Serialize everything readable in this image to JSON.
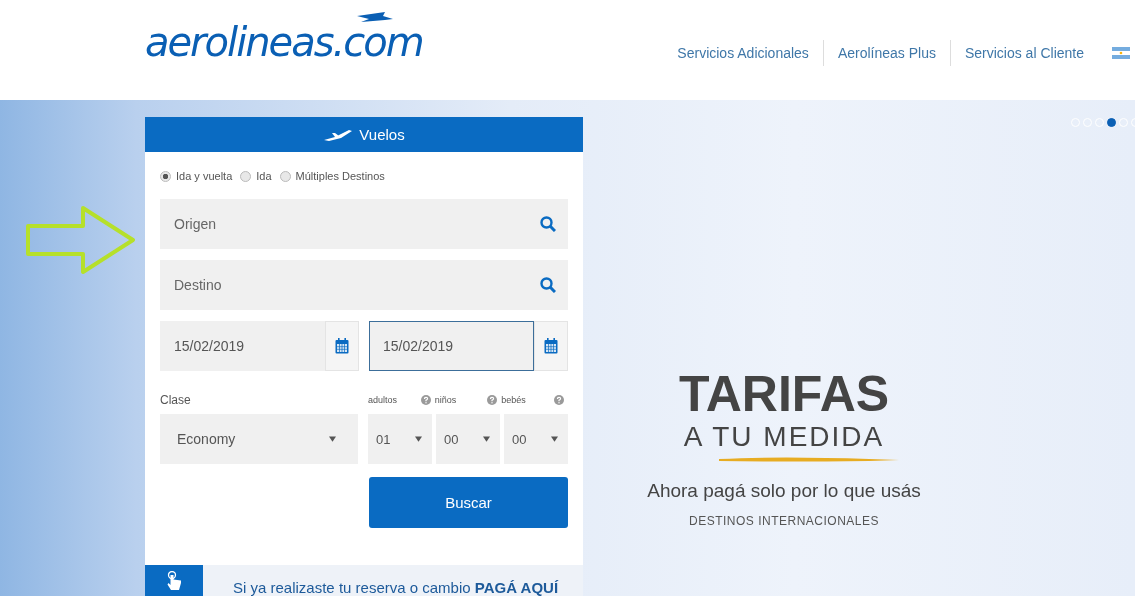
{
  "header": {
    "logo": "aerolineas.com",
    "nav": [
      "Servicios Adicionales",
      "Aerolíneas Plus",
      "Servicios al Cliente"
    ]
  },
  "slider": {
    "dots": [
      {
        "selected": false
      },
      {
        "selected": false
      },
      {
        "selected": false
      },
      {
        "selected": true
      },
      {
        "selected": false
      },
      {
        "selected": false
      }
    ]
  },
  "search": {
    "title": "Vuelos",
    "trip_types": [
      {
        "label": "Ida y vuelta",
        "selected": true
      },
      {
        "label": "Ida",
        "selected": false
      },
      {
        "label": "Múltiples Destinos",
        "selected": false
      }
    ],
    "origin": {
      "placeholder": "Origen"
    },
    "destination": {
      "placeholder": "Destino"
    },
    "dates": [
      {
        "value": "15/02/2019",
        "focused": false
      },
      {
        "value": "15/02/2019",
        "focused": true
      }
    ],
    "class": {
      "label": "Clase",
      "value": "Economy"
    },
    "passengers": [
      {
        "label": "adultos",
        "value": "01"
      },
      {
        "label": "niños",
        "value": "00"
      },
      {
        "label": "bebés",
        "value": "00"
      }
    ],
    "button": "Buscar",
    "banner": "Si ya realizaste tu reserva o cambio **PAGÁ AQUÍ**"
  },
  "promo": {
    "headline": "TARIFAS",
    "subheadline": "A TU MEDIDA",
    "tagline": "Ahora pagá solo por lo que usás",
    "note": "DESTINOS INTERNACIONALES"
  }
}
